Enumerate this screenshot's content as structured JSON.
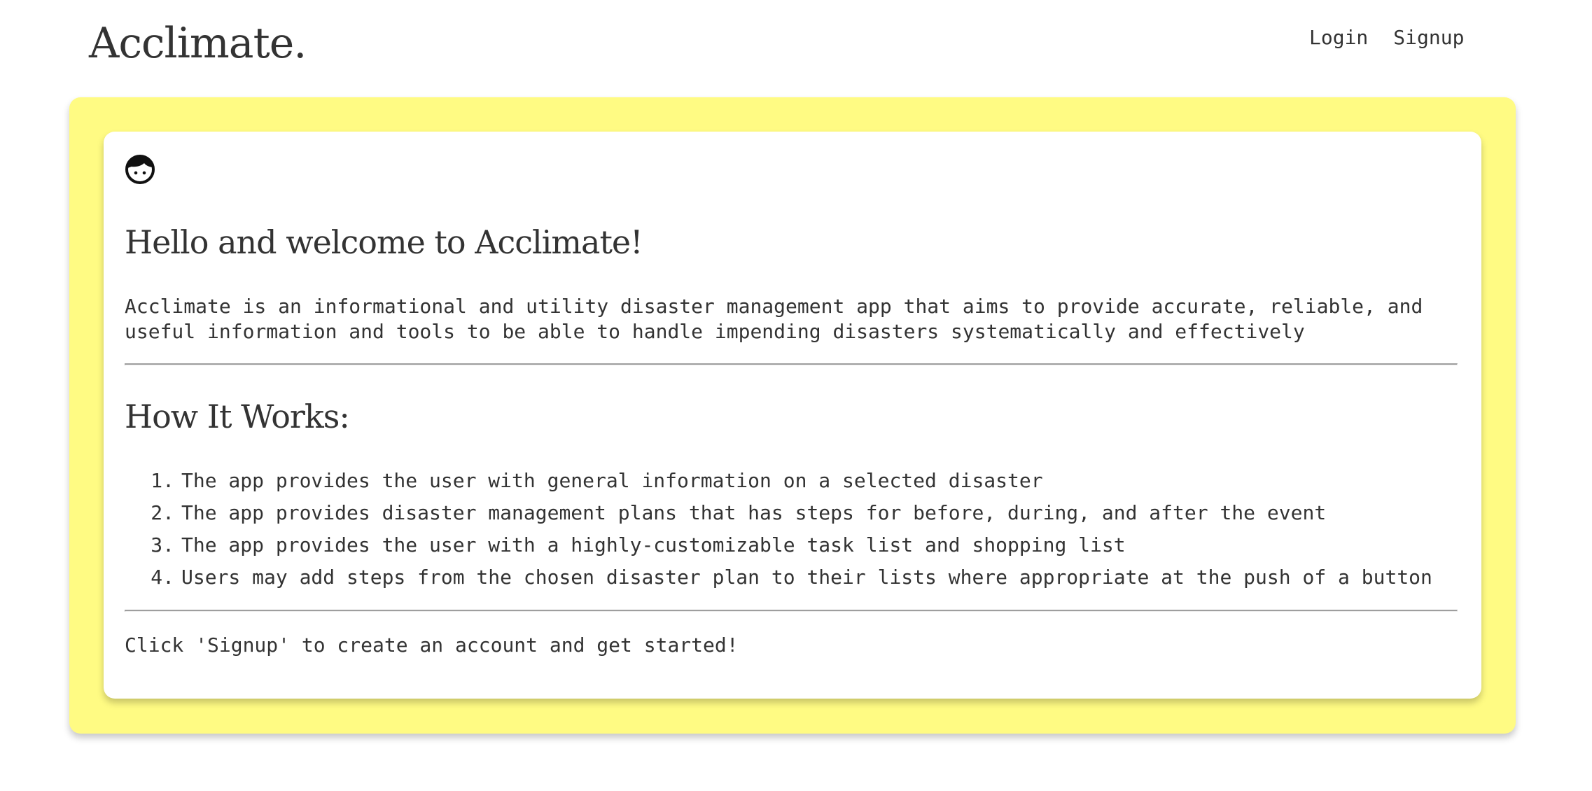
{
  "header": {
    "brand": "Acclimate.",
    "nav": {
      "login": "Login",
      "signup": "Signup"
    }
  },
  "card": {
    "icon": "face-icon",
    "welcome_heading": "Hello and welcome to Acclimate!",
    "intro": "Acclimate is an informational and utility disaster management app that aims to provide accurate, reliable, and useful information and tools to be able to handle impending disasters systematically and effectively",
    "how_heading": "How It Works:",
    "steps": [
      {
        "num": "1.",
        "text": "The app provides the user with general information on a selected disaster"
      },
      {
        "num": "2.",
        "text": "The app provides disaster management plans that has steps for before, during, and after the event"
      },
      {
        "num": "3.",
        "text": "The app provides the user with a highly-customizable task list and shopping list"
      },
      {
        "num": "4.",
        "text": "Users may add steps from the chosen disaster plan to their lists where appropriate at the push of a button"
      }
    ],
    "cta": "Click 'Signup' to create an account and get started!"
  },
  "colors": {
    "panel_background": "#fffb83",
    "card_background": "#ffffff",
    "text": "#333333",
    "divider": "#9e9e9e"
  }
}
